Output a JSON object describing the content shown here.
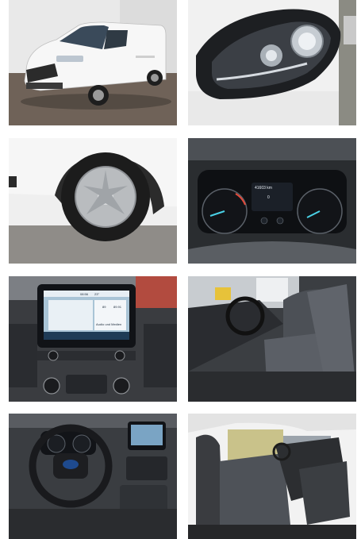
{
  "gallery": {
    "photos": [
      {
        "id": "exterior-front",
        "icon": "van-photo"
      },
      {
        "id": "headlight",
        "icon": "headlight-photo"
      },
      {
        "id": "wheel",
        "icon": "wheel-photo"
      },
      {
        "id": "instrument-cluster",
        "icon": "gauge-photo"
      },
      {
        "id": "infotainment",
        "icon": "screen-photo"
      },
      {
        "id": "cab-seats",
        "icon": "seat-photo"
      },
      {
        "id": "dashboard-steering",
        "icon": "steering-photo"
      },
      {
        "id": "cab-interior",
        "icon": "interior-photo"
      }
    ],
    "cluster_text": {
      "odometer": "41603 km",
      "digit": "0"
    },
    "screen_text": {
      "time": "08:56",
      "temp": "23°",
      "c1": "89",
      "c2": "89.91",
      "bottom": "Audio und Medien"
    }
  }
}
